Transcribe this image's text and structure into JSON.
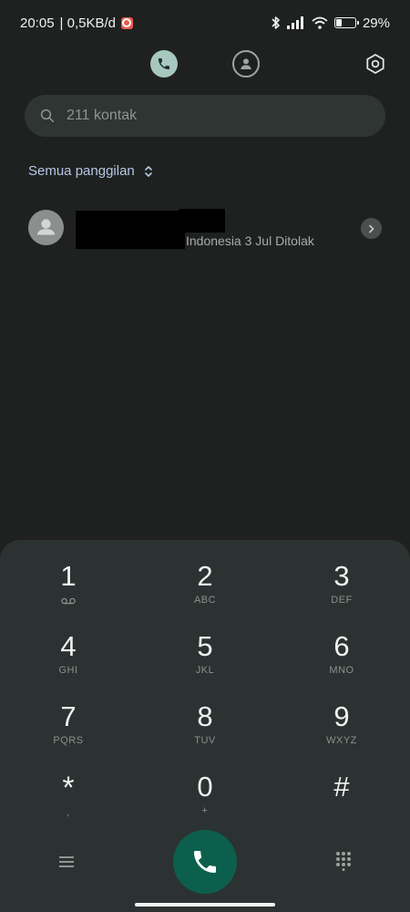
{
  "status_bar": {
    "time": "20:05",
    "net_speed": "| 0,5KB/d",
    "battery_percent": "29%",
    "battery_level": 0.29,
    "icons": [
      "bluetooth-icon",
      "signal-icon",
      "wifi-icon",
      "battery-icon"
    ]
  },
  "tabs": {
    "active": "calls",
    "items": [
      "phone-icon",
      "contacts-icon"
    ]
  },
  "search": {
    "placeholder": "211 kontak"
  },
  "filter": {
    "label": "Semua panggilan"
  },
  "call_log": [
    {
      "meta": "Indonesia 3 Jul Ditolak",
      "name_redacted": true
    }
  ],
  "dialpad": {
    "keys": [
      {
        "digit": "1",
        "sub": "voicemail-icon"
      },
      {
        "digit": "2",
        "sub": "ABC"
      },
      {
        "digit": "3",
        "sub": "DEF"
      },
      {
        "digit": "4",
        "sub": "GHI"
      },
      {
        "digit": "5",
        "sub": "JKL"
      },
      {
        "digit": "6",
        "sub": "MNO"
      },
      {
        "digit": "7",
        "sub": "PQRS"
      },
      {
        "digit": "8",
        "sub": "TUV"
      },
      {
        "digit": "9",
        "sub": "WXYZ"
      },
      {
        "digit": "*",
        "sub": ","
      },
      {
        "digit": "0",
        "sub": "+"
      },
      {
        "digit": "#",
        "sub": ""
      }
    ]
  },
  "colors": {
    "background": "#1f2120",
    "dialpad_bg": "#2b3231",
    "active_tab": "#a6c8be",
    "call_button": "#0d5f4d",
    "filter_text": "#b7c7e6"
  }
}
